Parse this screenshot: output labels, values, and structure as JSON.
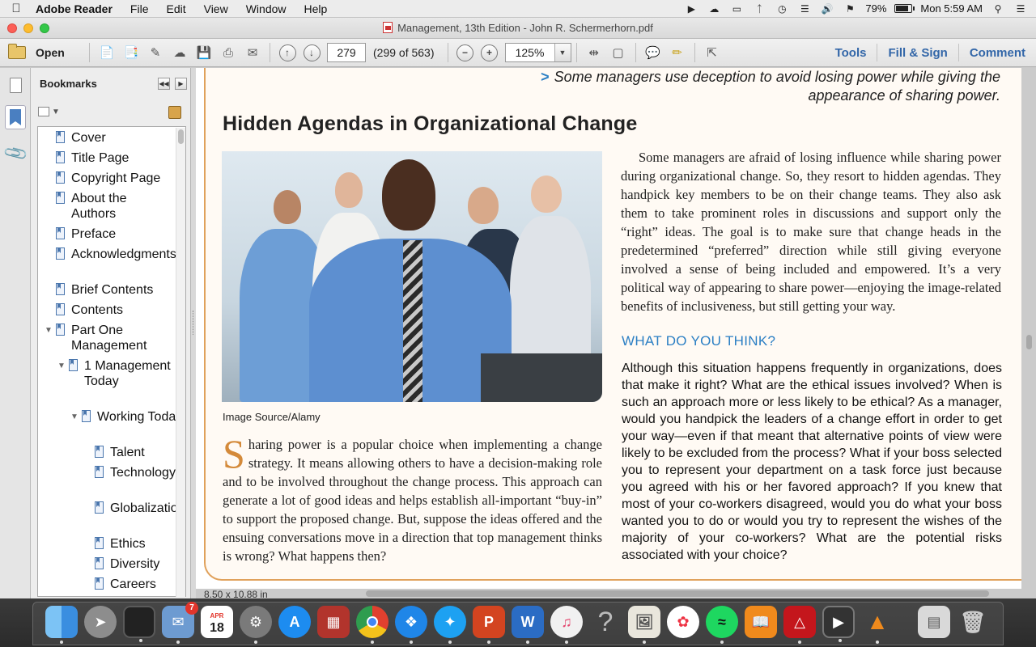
{
  "menubar": {
    "app_name": "Adobe Reader",
    "items": [
      "File",
      "Edit",
      "View",
      "Window",
      "Help"
    ],
    "battery_percent": "79%",
    "battery_level": 0.79,
    "clock": "Mon 5:59 AM"
  },
  "window": {
    "title": "Management, 13th Edition - John R. Schermerhorn.pdf"
  },
  "toolbar": {
    "open_label": "Open",
    "page_number": "279",
    "page_count": "(299 of 563)",
    "zoom": "125%",
    "tools_label": "Tools",
    "fill_sign_label": "Fill & Sign",
    "comment_label": "Comment"
  },
  "bookmarks": {
    "title": "Bookmarks",
    "items": [
      {
        "label": "Cover",
        "indent": 0,
        "expandable": false
      },
      {
        "label": "Title Page",
        "indent": 0,
        "expandable": false
      },
      {
        "label": "Copyright Page",
        "indent": 0,
        "expandable": false
      },
      {
        "label": "About the Authors",
        "indent": 0,
        "expandable": false
      },
      {
        "label": "Preface",
        "indent": 0,
        "expandable": false
      },
      {
        "label": "Acknowledgments",
        "indent": 0,
        "expandable": false
      },
      {
        "label": "Brief Contents",
        "indent": 0,
        "expandable": false
      },
      {
        "label": "Contents",
        "indent": 0,
        "expandable": false
      },
      {
        "label": "Part One Management",
        "indent": 0,
        "expandable": true
      },
      {
        "label": "1 Management Today",
        "indent": 1,
        "expandable": true
      },
      {
        "label": "Working Today",
        "indent": 2,
        "expandable": true
      },
      {
        "label": "Talent",
        "indent": 3,
        "expandable": false
      },
      {
        "label": "Technology",
        "indent": 3,
        "expandable": false
      },
      {
        "label": "Globalization",
        "indent": 3,
        "expandable": false
      },
      {
        "label": "Ethics",
        "indent": 3,
        "expandable": false
      },
      {
        "label": "Diversity",
        "indent": 3,
        "expandable": false
      },
      {
        "label": "Careers",
        "indent": 3,
        "expandable": false
      }
    ]
  },
  "document": {
    "pull_quote": "Some managers use deception to avoid losing power while giving the appearance of sharing power.",
    "heading": "Hidden Agendas in Organizational Change",
    "photo_caption": "Image Source/Alamy",
    "right_paragraph": "Some managers are afraid of losing influence while sharing power during organizational change. So, they resort to hidden agendas. They handpick key members to be on their change teams. They also ask them to take prominent roles in discussions and support only the “right” ideas. The goal is to make sure that change heads in the predetermined “preferred” direction while still giving everyone involved a sense of being included and empowered. It’s a very political way of appearing to share power—enjoying the image-related benefits of inclusiveness, but still getting your way.",
    "dropcap": "S",
    "left_paragraph": "haring power is a popular choice when implementing a change strategy. It means allowing others to have a decision-making role and to be involved throughout the change process. This approach can generate a lot of good ideas and helps establish all-important “buy-in” to support the proposed change. But, suppose the ideas offered and the ensuing conversations move in a direction that top management thinks is wrong? What happens then?",
    "what_title": "WHAT DO YOU THINK?",
    "what_text": "Although this situation happens frequently in organizations, does that make it right? What are the ethical issues involved? When is such an approach more or less likely to be ethical? As a manager, would you handpick the leaders of a change effort in order to get your way—even if that meant that alternative points of view were likely to be excluded from the process? What if your boss selected you to represent your department on a task force just because you agreed with his or her favored approach? If you knew that most of your co-workers disagreed, would you do what your boss wanted you to do or would you try to represent the wishes of the majority of your co-workers? What are the potential risks associated with your choice?",
    "page_size": "8.50 x 10.88 in"
  },
  "dock": {
    "calendar_month": "APR",
    "calendar_day": "18",
    "mail_badge": "7",
    "help_glyph": "?"
  }
}
